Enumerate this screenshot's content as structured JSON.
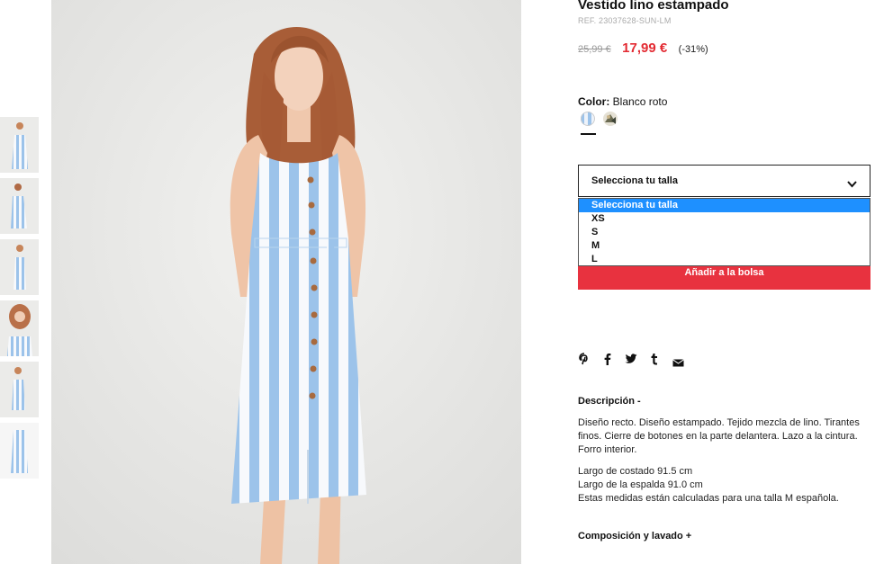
{
  "product": {
    "title": "Vestido lino estampado",
    "ref": "REF. 23037628-SUN-LM",
    "old_price": "25,99 €",
    "price": "17,99 €",
    "discount": "(-31%)"
  },
  "color": {
    "label": "Color:",
    "value": "Blanco roto",
    "swatches": [
      "swatch-blanco-roto",
      "swatch-estampado"
    ]
  },
  "size_select": {
    "label": "Selecciona tu talla",
    "options": [
      "Selecciona tu talla",
      "XS",
      "S",
      "M",
      "L"
    ],
    "selected_index": 0
  },
  "add_to_bag": "Añadir a la bolsa",
  "share_icons": [
    "pinterest-icon",
    "facebook-icon",
    "twitter-icon",
    "tumblr-icon",
    "mail-icon"
  ],
  "description": {
    "heading": "Descripción -",
    "paragraph1": "Diseño recto. Diseño estampado. Tejido mezcla de lino. Tirantes finos. Cierre de botones en la parte delantera. Lazo a la cintura. Forro interior.",
    "line1": "Largo de costado 91.5 cm",
    "line2": "Largo de la espalda 91.0 cm",
    "line3": "Estas medidas están calculadas para una talla M española."
  },
  "composition_heading": "Composición y lavado +",
  "colors": {
    "accent": "#e32b33",
    "button": "#e8323f",
    "highlight": "#1e90ff",
    "stripe": "#9cc3ea"
  }
}
